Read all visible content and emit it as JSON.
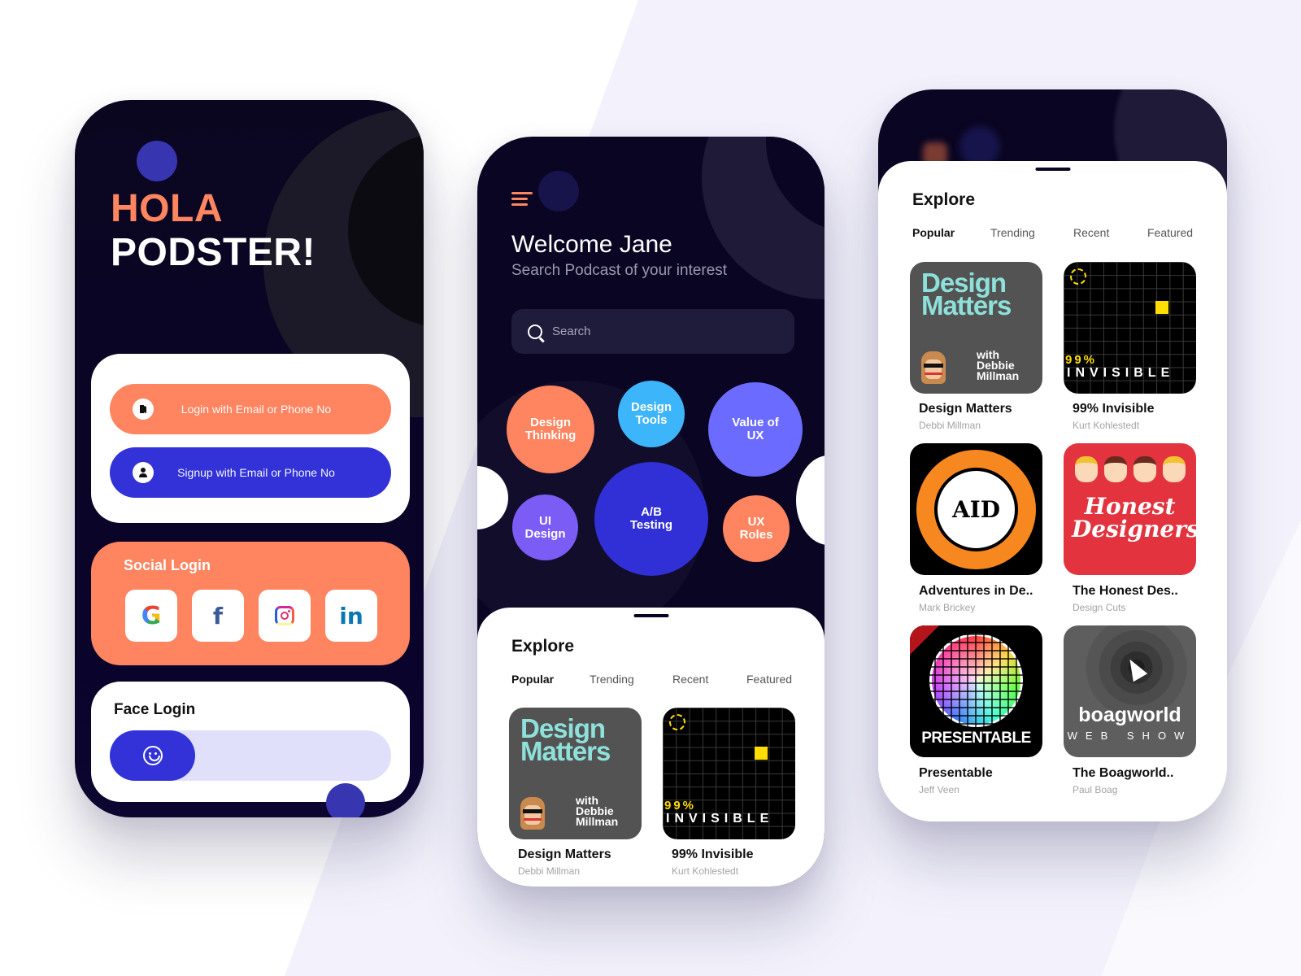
{
  "login_screen": {
    "title_line1": "HOLA",
    "title_line2": "PODSTER!",
    "login_button": "Login with Email or Phone No",
    "signup_button": "Signup with Email or Phone No",
    "social_login_title": "Social Login",
    "social_providers": [
      {
        "name": "Google",
        "glyph": "G",
        "icon": "google-icon"
      },
      {
        "name": "Facebook",
        "glyph": "f",
        "icon": "facebook-icon"
      },
      {
        "name": "Instagram",
        "glyph": "",
        "icon": "instagram-icon"
      },
      {
        "name": "LinkedIn",
        "glyph": "in",
        "icon": "linkedin-icon"
      }
    ],
    "face_login_title": "Face Login"
  },
  "home_screen": {
    "welcome": "Welcome Jane",
    "subtitle": "Search Podcast of your interest",
    "search_placeholder": "Search",
    "topics": [
      {
        "label": "Design\nThinking",
        "color": "#ff8460"
      },
      {
        "label": "Design\nTools",
        "color": "#3db5fa"
      },
      {
        "label": "Value of\nUX",
        "color": "#6b6bff"
      },
      {
        "label": "UI\nDesign",
        "color": "#7b5cf5"
      },
      {
        "label": "A/B\nTesting",
        "color": "#3030d6"
      },
      {
        "label": "UX\nRoles",
        "color": "#ff8460"
      }
    ]
  },
  "explore": {
    "title": "Explore",
    "tabs": [
      "Popular",
      "Trending",
      "Recent",
      "Featured"
    ],
    "active_tab": "Popular",
    "podcasts": [
      {
        "title": "Design Matters",
        "author": "Debbi Millman",
        "cover_text": "Design Matters",
        "cover_sub": "with Debbie Millman"
      },
      {
        "title": "99% Invisible",
        "author": "Kurt Kohlestedt",
        "cover_text": "99%",
        "cover_sub": "INVISIBLE"
      },
      {
        "title": "Adventures in De..",
        "author": "Mark Brickey",
        "cover_text": "AID"
      },
      {
        "title": "The Honest Des..",
        "author": "Design Cuts",
        "cover_text": "Honest Designers"
      },
      {
        "title": "Presentable",
        "author": "Jeff Veen",
        "cover_text": "PRESENTABLE"
      },
      {
        "title": "The Boagworld..",
        "author": "Paul Boag",
        "cover_text": "boagworld",
        "cover_sub": "WEB SHOW"
      }
    ]
  },
  "colors": {
    "accent_orange": "#ff8460",
    "accent_blue": "#3232d8",
    "dark_bg": "#0a0522",
    "face_track": "#e0e0fb"
  }
}
